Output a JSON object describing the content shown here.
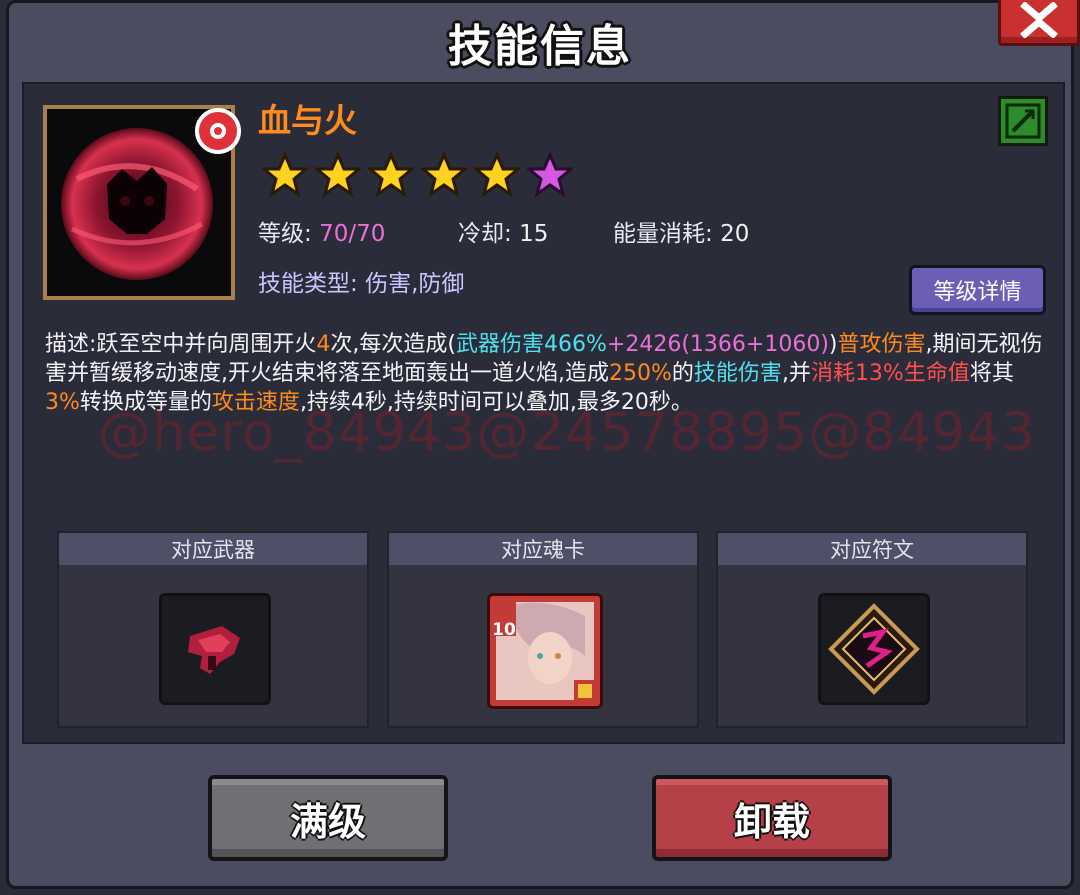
{
  "window": {
    "title": "技能信息",
    "close_label": "X"
  },
  "skill": {
    "name": "血与火",
    "stars": [
      {
        "color": "gold"
      },
      {
        "color": "gold"
      },
      {
        "color": "gold"
      },
      {
        "color": "gold"
      },
      {
        "color": "gold"
      },
      {
        "color": "purple"
      }
    ],
    "level_label": "等级:",
    "level_value": "70/70",
    "cooldown_label": "冷却:",
    "cooldown_value": "15",
    "energy_label": "能量消耗:",
    "energy_value": "20",
    "type_label": "技能类型:",
    "type_value": "伤害,防御",
    "detail_button": "等级详情",
    "icon": "blood-fire-orb-icon",
    "badge_icon": "red-badge-icon",
    "type_icon": "green-weapon-type-icon"
  },
  "description": {
    "p1": "描述:跃至空中并向周围开火",
    "n1": "4",
    "p2": "次,每次造成(",
    "weapon_dmg": "武器伤害466%",
    "plus": "+",
    "flat_dmg": "2426(1366+1060)",
    "p3": ")",
    "normal_attack": "普攻伤害",
    "p4": ",期间无视伤害并暂缓移动速度,开火结束将落至地面轰出一道火焰,造成",
    "pct250": "250%",
    "p5": "的",
    "skill_dmg": "技能伤害",
    "p6": ",并",
    "hp_cost": "消耗13%生命值",
    "p7": "将其",
    "pct3": "3%",
    "p8": "转换成等量的",
    "atk_speed": "攻击速度",
    "p9": ",持续4秒,持续时间可以叠加,最多20秒。"
  },
  "watermark": "@hero_84943@24578895@84943",
  "slots": [
    {
      "title": "对应武器",
      "icon": "crimson-gun-icon"
    },
    {
      "title": "对应魂卡",
      "icon": "soul-card-portrait",
      "card_level": "10"
    },
    {
      "title": "对应符文",
      "icon": "rune-diamond-icon"
    }
  ],
  "buttons": {
    "max_level": "满级",
    "unload": "卸载"
  },
  "colors": {
    "name_orange": "#ff8a1e",
    "cyan": "#4fe0ee",
    "pink": "#e870d6",
    "red": "#ff4f4f",
    "detail_button": "#6a5fb4",
    "unload_button": "#b64047",
    "max_button": "#6f6f74"
  }
}
